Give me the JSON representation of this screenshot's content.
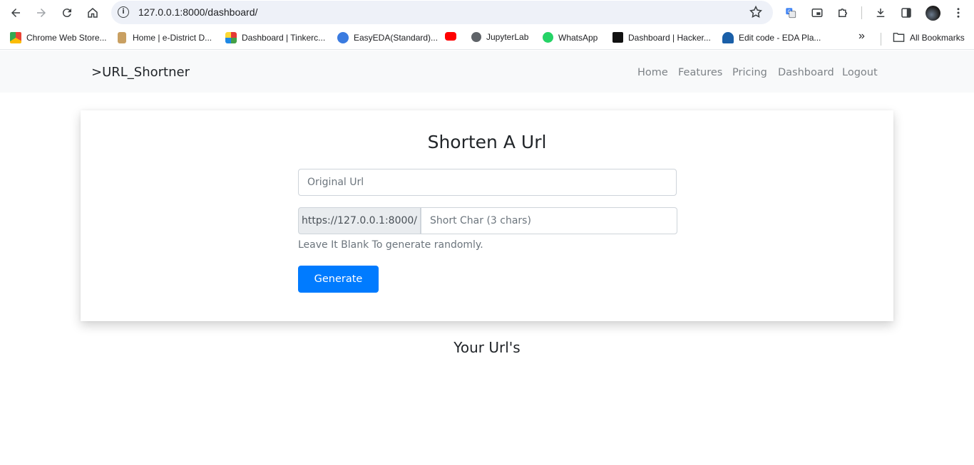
{
  "browser": {
    "url": "127.0.0.1:8000/dashboard/",
    "bookmarks": [
      {
        "label": "Chrome Web Store...",
        "color": "#e84a3a"
      },
      {
        "label": "Home | e-District D...",
        "color": "#b8893a"
      },
      {
        "label": "Dashboard | Tinkerc...",
        "color": "#2f8be0"
      },
      {
        "label": "EasyEDA(Standard)...",
        "color": "#3a7be0"
      },
      {
        "label": "",
        "color": "#ff0000"
      },
      {
        "label": "JupyterLab",
        "color": "#5f6368"
      },
      {
        "label": "WhatsApp",
        "color": "#25d366"
      },
      {
        "label": "Dashboard | Hacker...",
        "color": "#111111"
      },
      {
        "label": "Edit code - EDA Pla...",
        "color": "#1a5fa8"
      }
    ],
    "all_bookmarks": "All Bookmarks",
    "more_glyph": "»"
  },
  "site": {
    "brand": ">URL_Shortner",
    "nav": [
      "Home",
      "Features",
      "Pricing",
      "Dashboard",
      "Logout"
    ]
  },
  "form": {
    "title": "Shorten A Url",
    "original_placeholder": "Original Url",
    "prefix": "https://127.0.0.1:8000/",
    "short_placeholder": "Short Char (3 chars)",
    "help": "Leave It Blank To generate randomly.",
    "button": "Generate"
  },
  "urls_section": {
    "title": "Your Url's"
  },
  "colors": {
    "primary": "#007bff",
    "navbar_bg": "#f8f9fa"
  }
}
